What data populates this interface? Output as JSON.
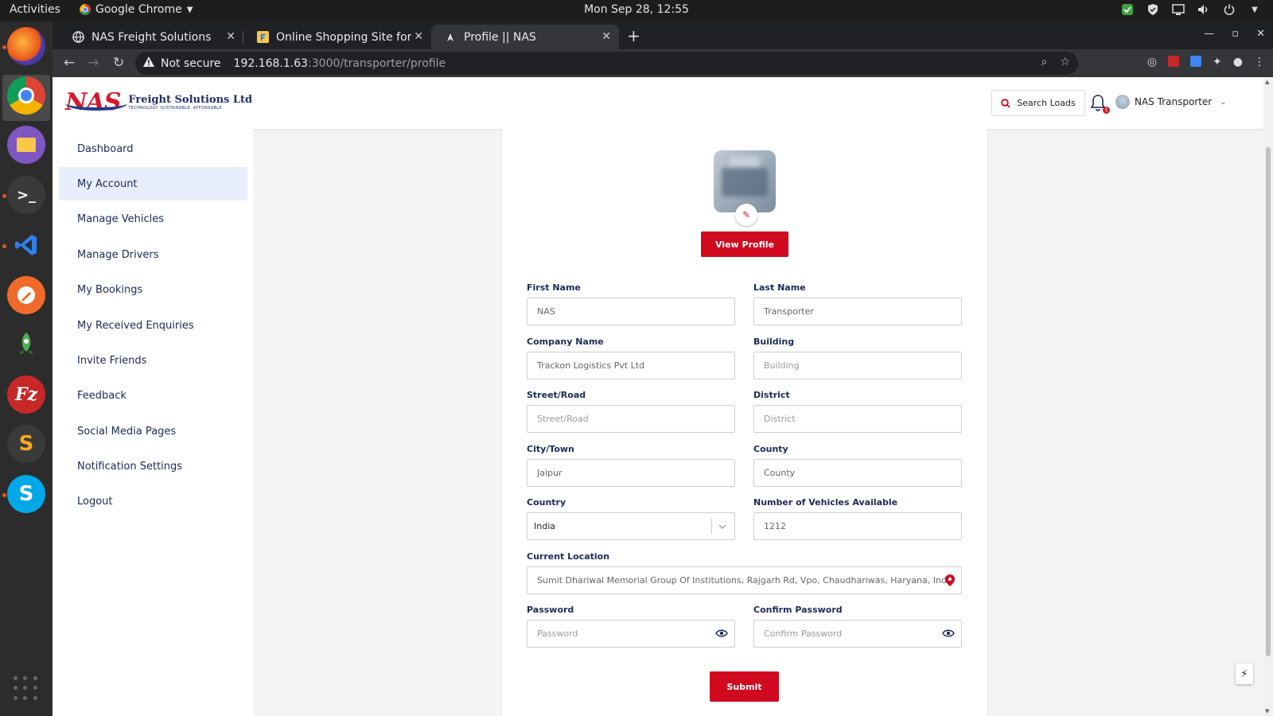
{
  "os": {
    "activities": "Activities",
    "app_name": "Google Chrome",
    "clock": "Mon Sep 28, 12:55"
  },
  "browser": {
    "tabs": [
      {
        "label": "NAS Freight Solutions"
      },
      {
        "label": "Online Shopping Site for"
      },
      {
        "label": "Profile || NAS"
      }
    ],
    "security": "Not secure",
    "url_host": "192.168.1.63",
    "url_path": ":3000/transporter/profile"
  },
  "header": {
    "logo_mark": "NAS",
    "logo_title": "Freight Solutions Ltd",
    "logo_tagline": "TECHNOLOGY. SUSTAINABLE. AFFORDABLE",
    "search_label": "Search Loads",
    "user_name": "NAS Transporter",
    "notification_count": "1"
  },
  "sidebar": {
    "items": [
      {
        "label": "Dashboard"
      },
      {
        "label": "My Account"
      },
      {
        "label": "Manage Vehicles"
      },
      {
        "label": "Manage Drivers"
      },
      {
        "label": "My Bookings"
      },
      {
        "label": "My Received Enquiries"
      },
      {
        "label": "Invite Friends"
      },
      {
        "label": "Feedback"
      },
      {
        "label": "Social Media Pages"
      },
      {
        "label": "Notification Settings"
      },
      {
        "label": "Logout"
      }
    ],
    "active_index": 1
  },
  "profile": {
    "view_profile_label": "View Profile",
    "submit_label": "Submit",
    "fields": {
      "first_name": {
        "label": "First Name",
        "value": "NAS"
      },
      "last_name": {
        "label": "Last Name",
        "value": "Transporter"
      },
      "company_name": {
        "label": "Company Name",
        "value": "Trackon Logistics Pvt Ltd"
      },
      "building": {
        "label": "Building",
        "placeholder": "Building"
      },
      "street": {
        "label": "Street/Road",
        "placeholder": "Street/Road"
      },
      "district": {
        "label": "District",
        "placeholder": "District"
      },
      "city": {
        "label": "City/Town",
        "value": "Jaipur"
      },
      "county": {
        "label": "County",
        "value": "County"
      },
      "country": {
        "label": "Country",
        "value": "India"
      },
      "vehicles": {
        "label": "Number of Vehicles Available",
        "value": "1212"
      },
      "location": {
        "label": "Current Location",
        "value": "Sumit Dhariwal Memorial Group Of Institutions, Rajgarh Rd, Vpo, Chaudhariwas, Haryana, India"
      },
      "password": {
        "label": "Password",
        "placeholder": "Password"
      },
      "confirm_password": {
        "label": "Confirm Password",
        "placeholder": "Confirm Password"
      }
    }
  },
  "colors": {
    "brand_red": "#d0091e",
    "brand_navy": "#1b2a55",
    "active_nav_bg": "#e8eefc"
  }
}
